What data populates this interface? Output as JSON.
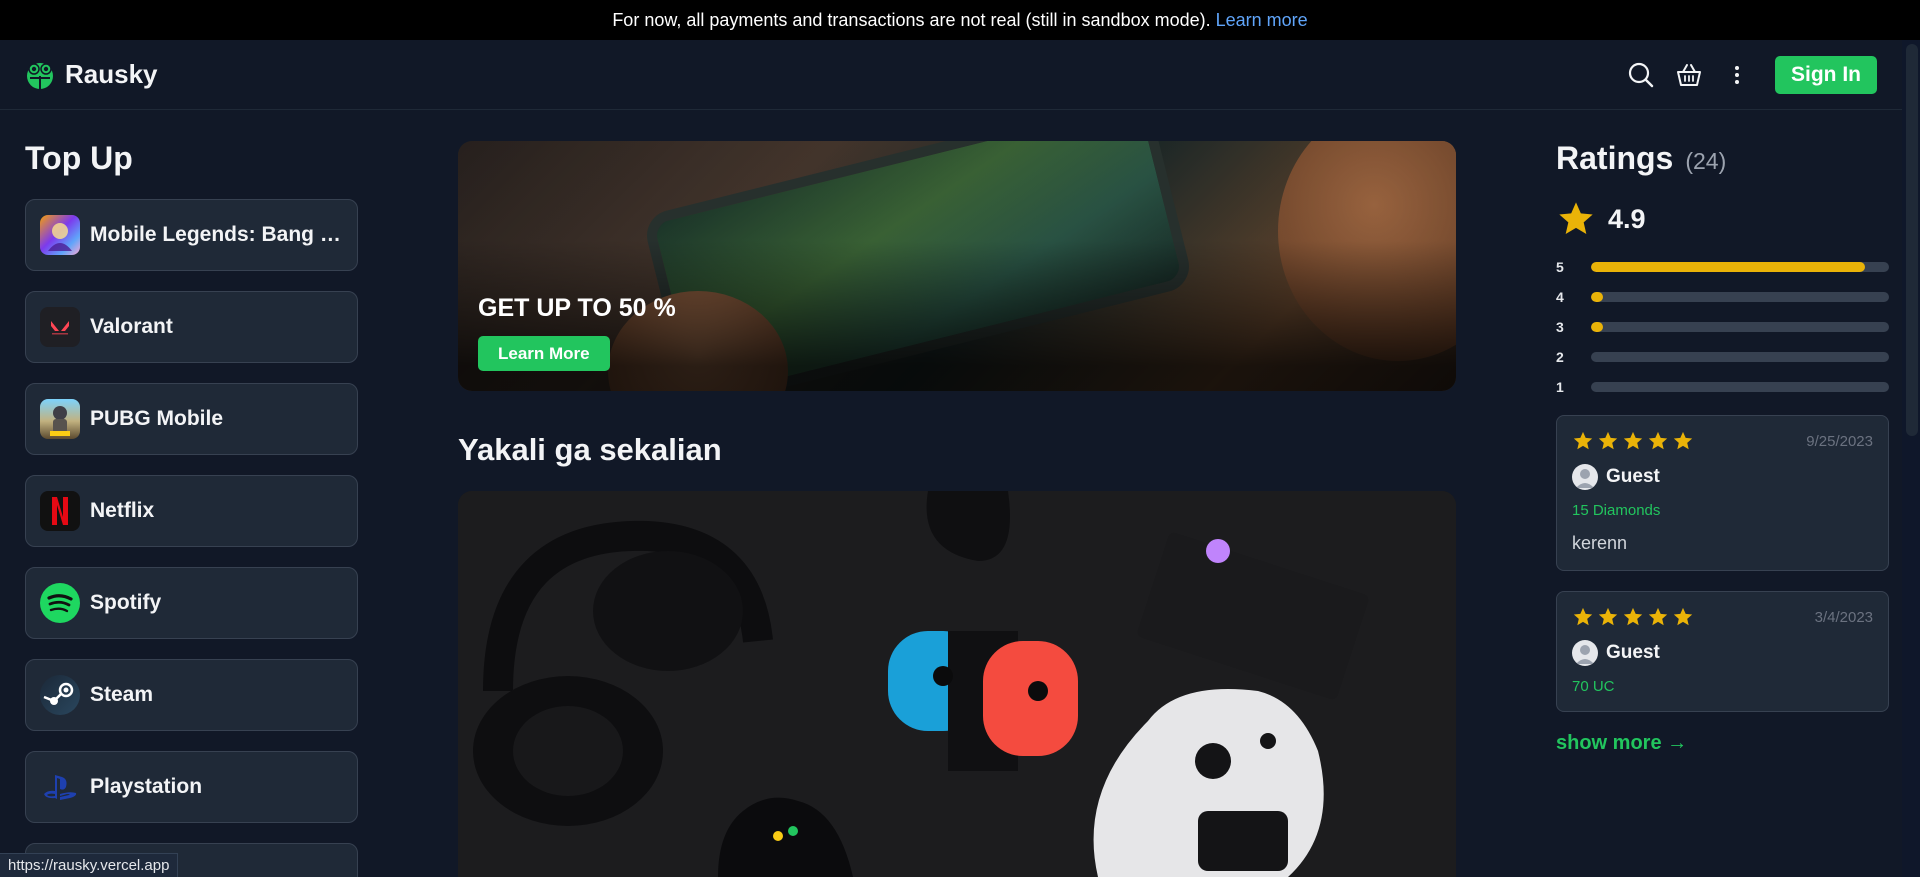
{
  "banner": {
    "text": "For now, all payments and transactions are not real (still in sandbox mode).",
    "link": "Learn more"
  },
  "header": {
    "brand": "Rausky",
    "signin_label": "Sign In",
    "icons": [
      "search-icon",
      "basket-icon",
      "more-vertical-icon"
    ]
  },
  "topup": {
    "title": "Top Up",
    "items": [
      {
        "label": "Mobile Legends: Bang B...",
        "icon": "mobile-legends-icon"
      },
      {
        "label": "Valorant",
        "icon": "valorant-icon"
      },
      {
        "label": "PUBG Mobile",
        "icon": "pubg-icon"
      },
      {
        "label": "Netflix",
        "icon": "netflix-icon"
      },
      {
        "label": "Spotify",
        "icon": "spotify-icon"
      },
      {
        "label": "Steam",
        "icon": "steam-icon"
      },
      {
        "label": "Playstation",
        "icon": "playstation-icon"
      }
    ]
  },
  "hero": {
    "title": "GET UP TO 50 %",
    "button": "Learn More"
  },
  "promo": {
    "title": "Yakali ga sekalian"
  },
  "ratings": {
    "title": "Ratings",
    "count": "(24)",
    "average": "4.9",
    "distribution": [
      {
        "stars": "5",
        "fraction": 0.92
      },
      {
        "stars": "4",
        "fraction": 0.04
      },
      {
        "stars": "3",
        "fraction": 0.04
      },
      {
        "stars": "2",
        "fraction": 0.0
      },
      {
        "stars": "1",
        "fraction": 0.0
      }
    ],
    "reviews": [
      {
        "stars": 5,
        "date": "9/25/2023",
        "name": "Guest",
        "product": "15 Diamonds",
        "text": "kerenn"
      },
      {
        "stars": 5,
        "date": "3/4/2023",
        "name": "Guest",
        "product": "70 UC",
        "text": ""
      }
    ],
    "show_more": "show more →"
  },
  "status_bar": {
    "url": "https://rausky.vercel.app"
  },
  "colors": {
    "accent": "#22c55e",
    "star": "#eab308",
    "background": "#111827",
    "card": "#1f2937",
    "link": "#60a5fa"
  }
}
